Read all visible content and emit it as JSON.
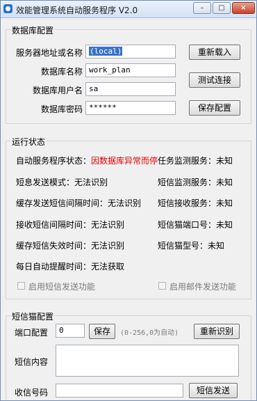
{
  "window": {
    "title": "效能管理系统自动服务程序 V2.0",
    "minimize": "–",
    "maximize": "□",
    "close": "×"
  },
  "db": {
    "legend": "数据库配置",
    "server_label": "服务器地址或名称",
    "server_value": "(local)",
    "dbname_label": "数据库名称",
    "dbname_value": "work_plan",
    "user_label": "数据库用户名",
    "user_value": "sa",
    "pwd_label": "数据库密码",
    "pwd_value": "******",
    "reload_button": "重新载入",
    "test_button": "测试连接",
    "save_button": "保存配置"
  },
  "status": {
    "legend": "运行状态",
    "auto_label": "自动服务程序状态：",
    "auto_value": "因数据库异常而停止运行",
    "task_monitor": "任务监测服务：未知",
    "sms_mode": "短息发送模式：无法识别",
    "sms_monitor": "短信监测服务：未知",
    "cache_interval": "缓存发送短信间隔时间：无法识别",
    "sms_receive": "短信接收服务：未知",
    "recv_interval": "接收短信间隔时间：无法识别",
    "cat_port": "短信猫端口号：未知",
    "cache_expire": "缓存短信失效时间：无法识别",
    "cat_model": "短信猫型号：未知",
    "daily_remind": "每日自动提醒时间：无法获取",
    "enable_sms": "启用短信发送功能",
    "enable_mail": "启用邮件发送功能"
  },
  "cat": {
    "legend": "短信猫配置",
    "port_label": "端口配置",
    "port_value": "0",
    "save_button": "保存",
    "port_hint": "(0-256,0为自动)",
    "reidentify_button": "重新识别",
    "content_label": "短信内容",
    "phone_label": "收信号码",
    "send_button": "短信发送"
  }
}
